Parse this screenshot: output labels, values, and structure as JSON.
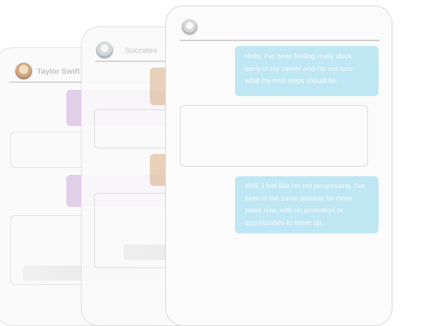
{
  "back_card": {
    "name": "Taylor Swift",
    "avatar": "woman-portrait-avatar"
  },
  "middle_card": {
    "name": "Socrates",
    "avatar": "marble-bust-avatar"
  },
  "front_card": {
    "avatar": "statue-avatar",
    "messages": [
      {
        "role": "user",
        "text": "Hello, I've been feeling really stuck lately in my career and I'm not sure what my next steps should be."
      },
      {
        "role": "assistant",
        "text": ""
      },
      {
        "role": "user",
        "text": "Well, I feel like I'm not progressing. I've been in the same position for three years now, with no promotion or opportunities to move up."
      }
    ]
  },
  "colors": {
    "user_bubble": "#bfe6f3",
    "purple_bubble": "#dcc6e6",
    "tan_bubble": "#e7cdb6",
    "card_border": "#dcdcdc"
  }
}
